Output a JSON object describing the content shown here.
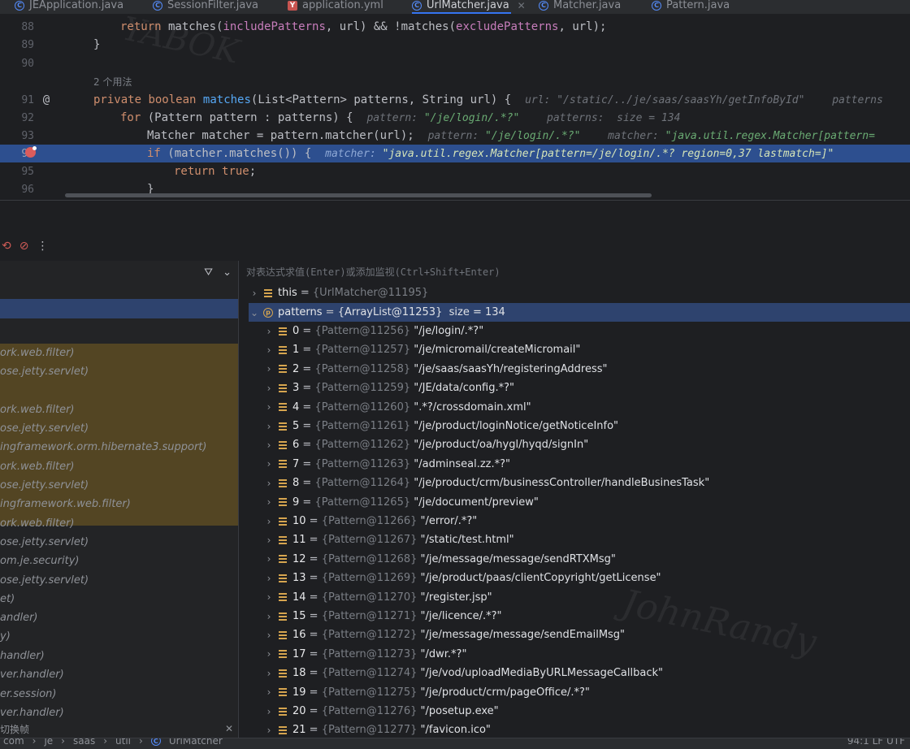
{
  "tabs": [
    {
      "label": "JEApplication.java",
      "icon": "c"
    },
    {
      "label": "SessionFilter.java",
      "icon": "c"
    },
    {
      "label": "application.yml",
      "icon": "y"
    },
    {
      "label": "UrlMatcher.java",
      "icon": "c",
      "active": true
    },
    {
      "label": "Matcher.java",
      "icon": "c"
    },
    {
      "label": "Pattern.java",
      "icon": "c"
    }
  ],
  "editor": {
    "line88": {
      "num": "88",
      "pre": "return",
      "mid1": " matches(",
      "f1": "includePatterns",
      "mid2": ", url) && !matches(",
      "f2": "excludePatterns",
      "end": ", url);"
    },
    "line89": {
      "num": "89",
      "code": "}"
    },
    "line90": {
      "num": "90"
    },
    "usage": "2 个用法",
    "line91": {
      "num": "91",
      "kw1": "private",
      "kw2": "boolean",
      "fn": "matches",
      "rest": "(List<Pattern> patterns, String url) {",
      "h1": "url: ",
      "v1": "\"/static/../je/saas/saasYh/getInfoById\"",
      "h2": "patterns"
    },
    "line92": {
      "num": "92",
      "kw": "for",
      "rest": " (Pattern pattern : patterns) {",
      "h1": "pattern: ",
      "v1": "\"/je/login/.*?\"",
      "h2": "patterns:  size = 134"
    },
    "line93": {
      "num": "93",
      "code": "Matcher matcher = pattern.matcher(url);",
      "h1": "pattern: ",
      "v1": "\"/je/login/.*?\"",
      "h2": "matcher: ",
      "v2": "\"java.util.regex.Matcher[pattern="
    },
    "line94": {
      "num": "94",
      "kw": "if",
      "rest": " (matcher.matches()) {",
      "h1": "matcher: ",
      "v1": "\"java.util.regex.Matcher[pattern=/je/login/.*? region=0,37 lastmatch=]\""
    },
    "line95": {
      "num": "95",
      "kw": "return",
      "kw2": "true",
      "end": ";"
    },
    "line96": {
      "num": "96",
      "code": "}"
    }
  },
  "debugger": {
    "eval_placeholder": "对表达式求值(Enter)或添加监视(Ctrl+Shift+Enter)",
    "frames": [
      "ork.web.filter)",
      "ose.jetty.servlet)",
      "ork.web.filter)",
      "ose.jetty.servlet)",
      "ingframework.orm.hibernate3.support)",
      "ork.web.filter)",
      "ose.jetty.servlet)",
      "ingframework.web.filter)",
      "ork.web.filter)",
      "ose.jetty.servlet)",
      "om.je.security)",
      "ose.jetty.servlet)",
      "et)",
      "andler)",
      "y)",
      "handler)",
      "ver.handler)",
      "er.session)",
      "ver.handler)"
    ],
    "frames_footer": "切换帧",
    "this_row": {
      "name": "this",
      "ref": "{UrlMatcher@11195}"
    },
    "patterns_row": {
      "name": "patterns",
      "ref": "{ArrayList@11253}",
      "extra": "size = 134"
    },
    "items": [
      {
        "idx": "0",
        "ref": "{Pattern@11256}",
        "val": "\"/je/login/.*?\""
      },
      {
        "idx": "1",
        "ref": "{Pattern@11257}",
        "val": "\"/je/micromail/createMicromail\""
      },
      {
        "idx": "2",
        "ref": "{Pattern@11258}",
        "val": "\"/je/saas/saasYh/registeringAddress\""
      },
      {
        "idx": "3",
        "ref": "{Pattern@11259}",
        "val": "\"/JE/data/config.*?\""
      },
      {
        "idx": "4",
        "ref": "{Pattern@11260}",
        "val": "\".*?/crossdomain.xml\""
      },
      {
        "idx": "5",
        "ref": "{Pattern@11261}",
        "val": "\"/je/product/loginNotice/getNoticeInfo\""
      },
      {
        "idx": "6",
        "ref": "{Pattern@11262}",
        "val": "\"/je/product/oa/hygl/hyqd/signIn\""
      },
      {
        "idx": "7",
        "ref": "{Pattern@11263}",
        "val": "\"/adminseal.zz.*?\""
      },
      {
        "idx": "8",
        "ref": "{Pattern@11264}",
        "val": "\"/je/product/crm/businessController/handleBusinesTask\""
      },
      {
        "idx": "9",
        "ref": "{Pattern@11265}",
        "val": "\"/je/document/preview\""
      },
      {
        "idx": "10",
        "ref": "{Pattern@11266}",
        "val": "\"/error/.*?\""
      },
      {
        "idx": "11",
        "ref": "{Pattern@11267}",
        "val": "\"/static/test.html\""
      },
      {
        "idx": "12",
        "ref": "{Pattern@11268}",
        "val": "\"/je/message/message/sendRTXMsg\""
      },
      {
        "idx": "13",
        "ref": "{Pattern@11269}",
        "val": "\"/je/product/paas/clientCopyright/getLicense\""
      },
      {
        "idx": "14",
        "ref": "{Pattern@11270}",
        "val": "\"/register.jsp\""
      },
      {
        "idx": "15",
        "ref": "{Pattern@11271}",
        "val": "\"/je/licence/.*?\""
      },
      {
        "idx": "16",
        "ref": "{Pattern@11272}",
        "val": "\"/je/message/message/sendEmailMsg\""
      },
      {
        "idx": "17",
        "ref": "{Pattern@11273}",
        "val": "\"/dwr.*?\""
      },
      {
        "idx": "18",
        "ref": "{Pattern@11274}",
        "val": "\"/je/vod/uploadMediaByURLMessageCallback\""
      },
      {
        "idx": "19",
        "ref": "{Pattern@11275}",
        "val": "\"/je/product/crm/pageOffice/.*?\""
      },
      {
        "idx": "20",
        "ref": "{Pattern@11276}",
        "val": "\"/posetup.exe\""
      },
      {
        "idx": "21",
        "ref": "{Pattern@11277}",
        "val": "\"/favicon.ico\""
      }
    ]
  },
  "status": {
    "crumbs": [
      "com",
      "je",
      "saas",
      "util",
      "UrlMatcher"
    ],
    "right": "94:1  LF  UTF"
  },
  "colors": {
    "accent": "#3574f0",
    "selection": "#2e436e",
    "execution_line": "#2d4f8f",
    "breakpoint": "#db5c5c"
  }
}
